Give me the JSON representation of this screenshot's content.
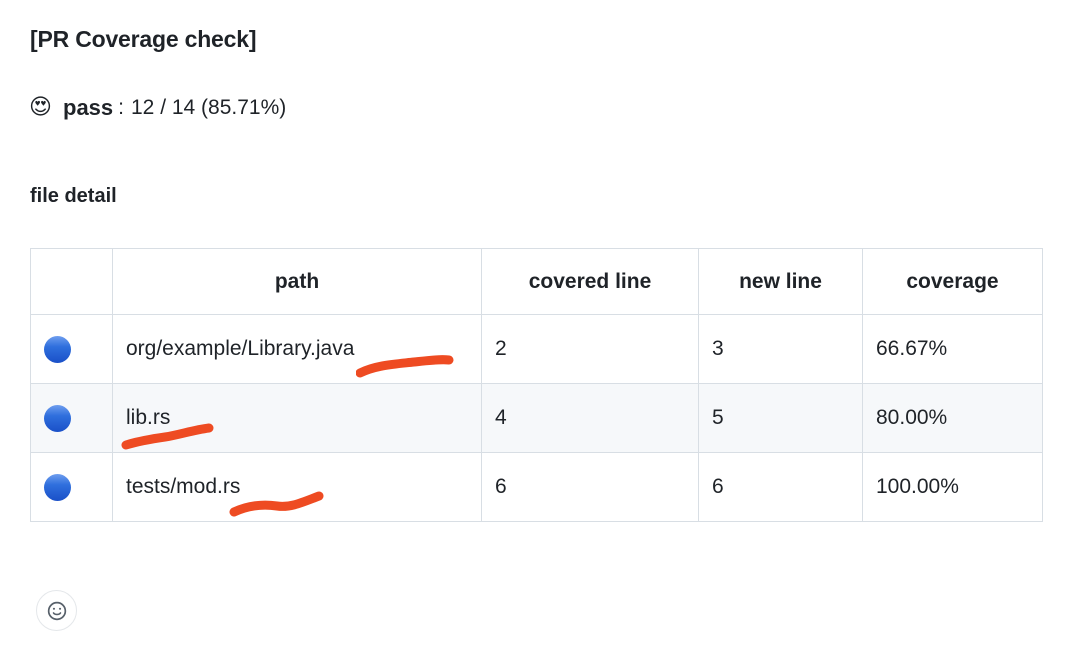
{
  "report": {
    "title": "[PR Coverage check]",
    "status": {
      "emoji": "😍",
      "emoji_name": "smiling-face-with-heart-eyes",
      "label": "pass",
      "separator": ":",
      "value": "12 / 14 (85.71%)",
      "covered": 12,
      "total": 14,
      "percent": "85.71%"
    },
    "section_heading": "file detail"
  },
  "table": {
    "columns": [
      "",
      "path",
      "covered line",
      "new line",
      "coverage"
    ],
    "rows": [
      {
        "marker": "🔵",
        "marker_name": "blue-circle",
        "path": "org/example/Library.java",
        "covered_line": "2",
        "new_line": "3",
        "coverage": "66.67%"
      },
      {
        "marker": "🔵",
        "marker_name": "blue-circle",
        "path": "lib.rs",
        "covered_line": "4",
        "new_line": "5",
        "coverage": "80.00%"
      },
      {
        "marker": "🔵",
        "marker_name": "blue-circle",
        "path": "tests/mod.rs",
        "covered_line": "6",
        "new_line": "6",
        "coverage": "100.00%"
      }
    ]
  },
  "annotations": {
    "color": "#ee4b22",
    "strokes": [
      {
        "target": "org/example/Library.java",
        "shape": "underline-scribble"
      },
      {
        "target": "lib.rs",
        "shape": "underline-scribble"
      },
      {
        "target": "tests/mod.rs",
        "shape": "underline-scribble"
      }
    ]
  },
  "footer": {
    "reaction_button": {
      "icon": "smiley-face-icon",
      "tooltip": "Add reaction"
    }
  },
  "colors": {
    "text": "#1f2328",
    "border": "#d8dee4",
    "zebra": "#f6f8fa",
    "marker_blue": "#2f6fdd",
    "annotation_red": "#ee4b22"
  }
}
